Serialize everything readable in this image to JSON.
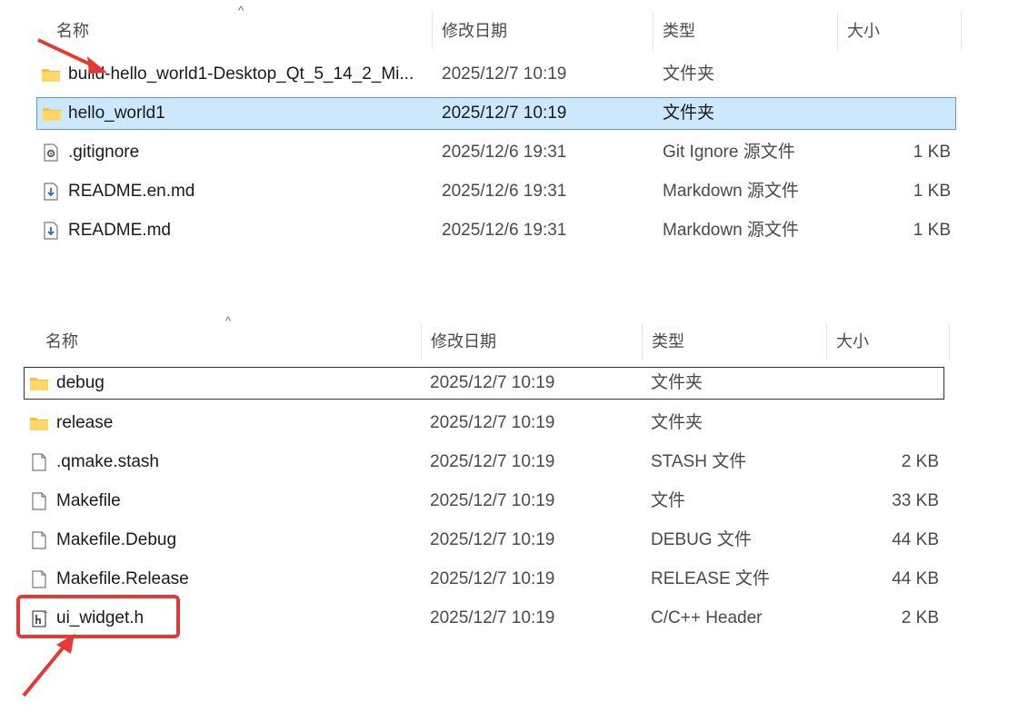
{
  "pane1": {
    "columns": {
      "name": "名称",
      "date": "修改日期",
      "type": "类型",
      "size": "大小"
    },
    "sort_indicator": "^",
    "rows": [
      {
        "name": "build-hello_world1-Desktop_Qt_5_14_2_Mi...",
        "date": "2025/12/7 10:19",
        "type": "文件夹",
        "size": "",
        "icon": "folder-icon"
      },
      {
        "name": "hello_world1",
        "date": "2025/12/7 10:19",
        "type": "文件夹",
        "size": "",
        "icon": "folder-icon"
      },
      {
        "name": ".gitignore",
        "date": "2025/12/6 19:31",
        "type": "Git Ignore 源文件",
        "size": "1 KB",
        "icon": "settings-file-icon"
      },
      {
        "name": "README.en.md",
        "date": "2025/12/6 19:31",
        "type": "Markdown 源文件",
        "size": "1 KB",
        "icon": "markdown-file-icon"
      },
      {
        "name": "README.md",
        "date": "2025/12/6 19:31",
        "type": "Markdown 源文件",
        "size": "1 KB",
        "icon": "markdown-file-icon"
      }
    ]
  },
  "pane2": {
    "columns": {
      "name": "名称",
      "date": "修改日期",
      "type": "类型",
      "size": "大小"
    },
    "sort_indicator": "^",
    "rows": [
      {
        "name": "debug",
        "date": "2025/12/7 10:19",
        "type": "文件夹",
        "size": "",
        "icon": "folder-icon"
      },
      {
        "name": "release",
        "date": "2025/12/7 10:19",
        "type": "文件夹",
        "size": "",
        "icon": "folder-icon"
      },
      {
        "name": ".qmake.stash",
        "date": "2025/12/7 10:19",
        "type": "STASH 文件",
        "size": "2 KB",
        "icon": "file-icon"
      },
      {
        "name": "Makefile",
        "date": "2025/12/7 10:19",
        "type": "文件",
        "size": "33 KB",
        "icon": "file-icon"
      },
      {
        "name": "Makefile.Debug",
        "date": "2025/12/7 10:19",
        "type": "DEBUG 文件",
        "size": "44 KB",
        "icon": "file-icon"
      },
      {
        "name": "Makefile.Release",
        "date": "2025/12/7 10:19",
        "type": "RELEASE 文件",
        "size": "44 KB",
        "icon": "file-icon"
      },
      {
        "name": "ui_widget.h",
        "date": "2025/12/7 10:19",
        "type": "C/C++ Header",
        "size": "2 KB",
        "icon": "header-file-icon"
      }
    ]
  },
  "colors": {
    "selection": "#cce8ff",
    "selection_border": "#5a9ad6",
    "annotation": "#e53935",
    "folder": "#f3c245"
  }
}
